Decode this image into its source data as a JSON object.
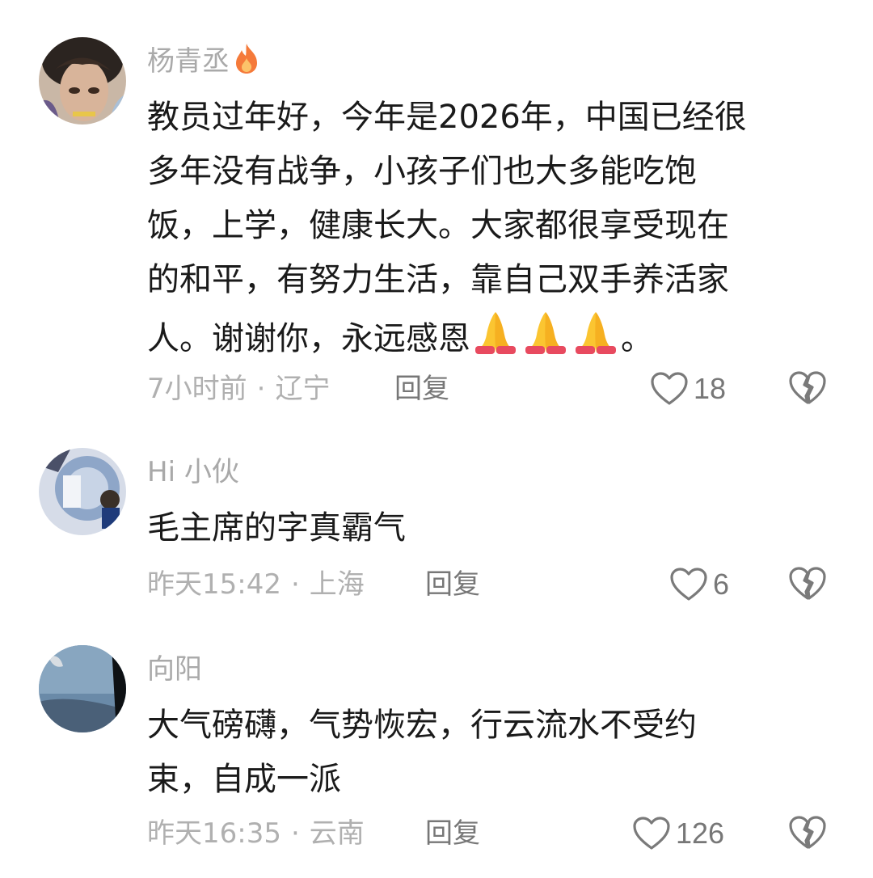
{
  "comments": [
    {
      "username": "杨青丞",
      "text_lines": [
        "教员过年好，今年是2026年，中国已经很",
        "多年没有战争，小孩子们也大多能吃饱",
        "饭，上学，健康长大。大家都很享受现在",
        "的和平，有努力生活，靠自己双手养活家"
      ],
      "last_line_text": "人。谢谢你，永远感恩",
      "last_line_end": "。",
      "time": "7小时前",
      "location": "辽宁",
      "reply_label": "回复",
      "likes": "18"
    },
    {
      "username": "Hi 小伙",
      "text": "毛主席的字真霸气",
      "time": "昨天15:42",
      "location": "上海",
      "reply_label": "回复",
      "likes": "6"
    },
    {
      "username": "向阳",
      "text_lines": [
        "大气磅礴，气势恢宏，行云流水不受约",
        "束，自成一派"
      ],
      "time": "昨天16:35",
      "location": "云南",
      "reply_label": "回复",
      "likes": "126"
    }
  ],
  "icons": {
    "like": "heart-outline-icon",
    "dislike": "broken-heart-icon",
    "badge": "fire-icon",
    "emoji": "folded-hands-icon"
  },
  "colors": {
    "username": "#a9a9a9",
    "body": "#1a1a1a",
    "meta": "#b0b0b0",
    "reply": "#777777"
  },
  "separator": "·"
}
